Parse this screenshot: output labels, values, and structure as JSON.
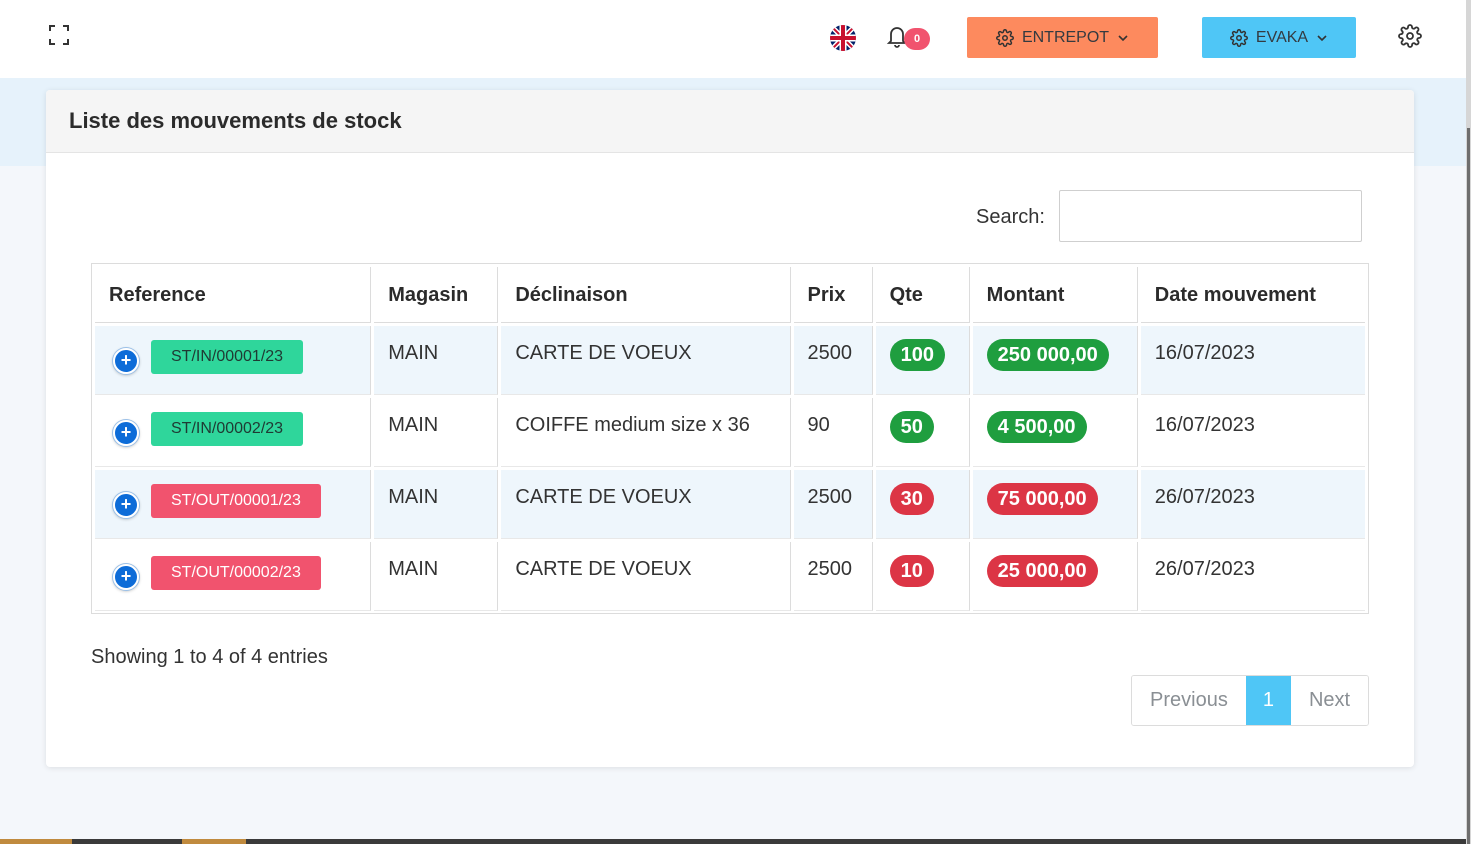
{
  "header": {
    "notification_count": "0",
    "entrepot_label": "ENTREPOT",
    "user_label": "EVAKA",
    "accent_orange": "#fd8a5e",
    "accent_blue": "#4fc6f6"
  },
  "card": {
    "title": "Liste des mouvements de stock",
    "search_label": "Search:",
    "search_value": ""
  },
  "table": {
    "columns": [
      "Reference",
      "Magasin",
      "Déclinaison",
      "Prix",
      "Qte",
      "Montant",
      "Date mouvement"
    ],
    "rows": [
      {
        "reference": "ST/IN/00001/23",
        "type": "in",
        "magasin": "MAIN",
        "declinaison": "CARTE DE VOEUX",
        "prix": "2500",
        "qte": "100",
        "montant": "250 000,00",
        "date": "16/07/2023"
      },
      {
        "reference": "ST/IN/00002/23",
        "type": "in",
        "magasin": "MAIN",
        "declinaison": "COIFFE medium size x 36",
        "prix": "90",
        "qte": "50",
        "montant": "4 500,00",
        "date": "16/07/2023"
      },
      {
        "reference": "ST/OUT/00001/23",
        "type": "out",
        "magasin": "MAIN",
        "declinaison": "CARTE DE VOEUX",
        "prix": "2500",
        "qte": "30",
        "montant": "75 000,00",
        "date": "26/07/2023"
      },
      {
        "reference": "ST/OUT/00002/23",
        "type": "out",
        "magasin": "MAIN",
        "declinaison": "CARTE DE VOEUX",
        "prix": "2500",
        "qte": "10",
        "montant": "25 000,00",
        "date": "26/07/2023"
      }
    ]
  },
  "footer": {
    "info": "Showing 1 to 4 of 4 entries",
    "previous": "Previous",
    "page": "1",
    "next": "Next"
  },
  "icons": {
    "fullscreen": "fullscreen-icon",
    "flag": "uk-flag-icon",
    "bell": "bell-icon",
    "gear": "gear-icon",
    "chevron": "chevron-down-icon",
    "expand": "plus-circle-icon"
  }
}
